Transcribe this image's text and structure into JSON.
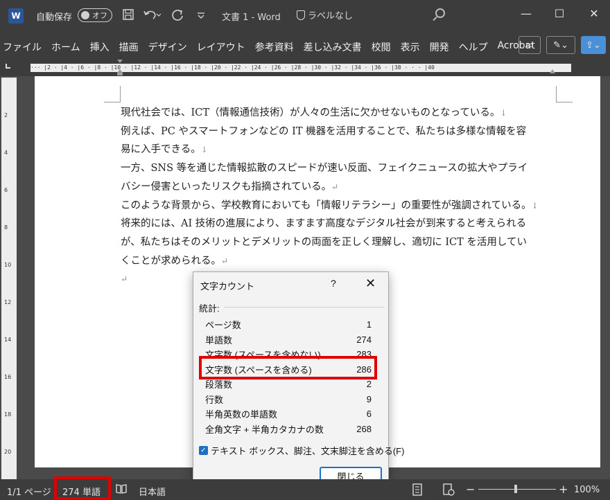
{
  "titlebar": {
    "logo_text": "W",
    "autosave_label": "自動保存",
    "autosave_state": "オフ",
    "document_title": "文書 1 - Word",
    "sensitivity_label": "ラベルなし",
    "icons": [
      "save-icon",
      "undo-icon",
      "redo-icon",
      "customize-icon",
      "search-icon"
    ],
    "window_controls": {
      "minimize": "—",
      "maximize": "☐",
      "close": "✕"
    }
  },
  "ribbon": {
    "tabs": [
      "ファイル",
      "ホーム",
      "挿入",
      "描画",
      "デザイン",
      "レイアウト",
      "参考資料",
      "差し込み文書",
      "校閲",
      "表示",
      "開発",
      "ヘルプ",
      "Acrobat"
    ],
    "comment_icon": "▭",
    "editing_icon": "✎⌄",
    "share_icon": "⇪⌄"
  },
  "ruler": {
    "text": "··· |2 · |4 · |6 · |8 · |10 · |12 · |14 · |16 · |18 · |20 · |22 · |24 · |26 · |28 · |30 · |32 · |34 · |36 · |38 · · · |40",
    "vertical_numbers": [
      "2",
      "4",
      "6",
      "8",
      "10",
      "12",
      "14",
      "16",
      "18",
      "20"
    ]
  },
  "document": {
    "lines": [
      {
        "text": "現代社会では、ICT（情報通信技術）が人々の生活に欠かせないものとなっている。",
        "mark": "↓"
      },
      {
        "text": "例えば、PC やスマートフォンなどの IT 機器を活用することで、私たちは多様な情報を容",
        "mark": ""
      },
      {
        "text": "易に入手できる。",
        "mark": "↓"
      },
      {
        "text": "一方、SNS 等を通じた情報拡散のスピードが速い反面、フェイクニュースの拡大やプライ",
        "mark": ""
      },
      {
        "text": "バシー侵害といったリスクも指摘されている。",
        "mark": "↵"
      },
      {
        "text": "このような背景から、学校教育においても「情報リテラシー」の重要性が強調されている。",
        "mark": "↓"
      },
      {
        "text": "将来的には、AI 技術の進展により、ますます高度なデジタル社会が到来すると考えられる",
        "mark": ""
      },
      {
        "text": "が、私たちはそのメリットとデメリットの両面を正しく理解し、適切に ICT を活用してい",
        "mark": ""
      },
      {
        "text": "くことが求められる。",
        "mark": "↵"
      },
      {
        "text": "",
        "mark": "↵"
      }
    ]
  },
  "dialog": {
    "title": "文字カウント",
    "help": "?",
    "close": "✕",
    "section_label": "統計:",
    "stats": [
      {
        "label": "ページ数",
        "value": "1"
      },
      {
        "label": "単語数",
        "value": "274"
      },
      {
        "label": "文字数 (スペースを含めない)",
        "value": "283"
      },
      {
        "label": "文字数 (スペースを含める)",
        "value": "286"
      },
      {
        "label": "段落数",
        "value": "2"
      },
      {
        "label": "行数",
        "value": "9"
      },
      {
        "label": "半角英数の単語数",
        "value": "6"
      },
      {
        "label": "全角文字 + 半角カタカナの数",
        "value": "268"
      }
    ],
    "checkbox_label": "テキスト ボックス、脚注、文末脚注を含める(F)",
    "checkbox_checked": true,
    "close_button": "閉じる"
  },
  "statusbar": {
    "page": "1/1 ページ",
    "words": "274 単語",
    "language": "日本語",
    "zoom_minus": "−",
    "zoom_plus": "+",
    "zoom": "100%",
    "zoom_level_percent": 100
  },
  "colors": {
    "highlight": "#e00000",
    "accent": "#1e6fc5",
    "chrome": "#3c3c3c"
  }
}
